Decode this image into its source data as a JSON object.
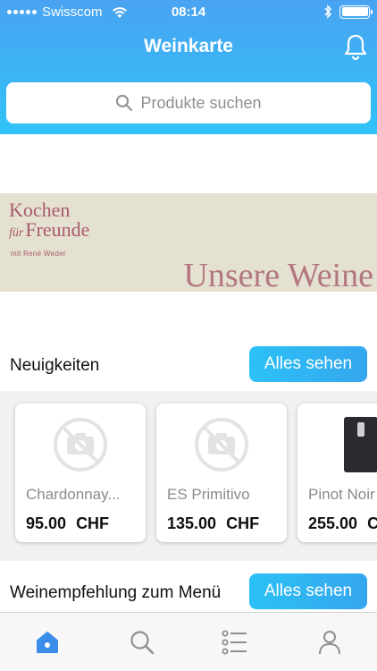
{
  "status_bar": {
    "carrier": "Swisscom",
    "time": "08:14"
  },
  "header": {
    "title": "Weinkarte"
  },
  "search": {
    "placeholder": "Produkte suchen"
  },
  "banner": {
    "line1": "Kochen",
    "line2_small": "für",
    "line2": "Freunde",
    "subtitle": "mit René Weder",
    "headline": "Unsere Weine"
  },
  "sections": [
    {
      "label": "Neuigkeiten",
      "button": "Alles sehen"
    },
    {
      "label": "Weinempfehlung zum Menü",
      "button": "Alles sehen"
    }
  ],
  "products": [
    {
      "name": "Chardonnay...",
      "price": "95.00",
      "currency": "CHF",
      "image": "no-image"
    },
    {
      "name": "ES Primitivo",
      "price": "135.00",
      "currency": "CHF",
      "image": "no-image"
    },
    {
      "name": "Pinot Noir",
      "price": "255.00",
      "currency": "CHF",
      "image": "wine-bottle"
    }
  ],
  "tabs": [
    {
      "icon": "home-icon",
      "active": true
    },
    {
      "icon": "search-icon",
      "active": false
    },
    {
      "icon": "list-icon",
      "active": false
    },
    {
      "icon": "profile-icon",
      "active": false
    }
  ],
  "colors": {
    "accent": "#3aa4ee",
    "header_gradient_top": "#4aa3f2",
    "header_gradient_bottom": "#2fc3f7",
    "banner_bg": "#e5e1d0",
    "banner_text": "#a85b6b"
  }
}
